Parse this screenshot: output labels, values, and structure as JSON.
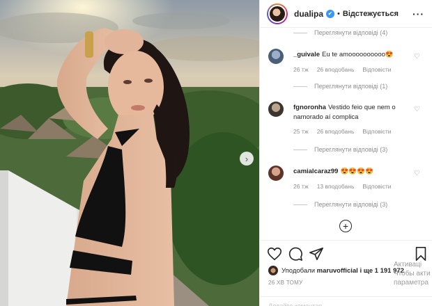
{
  "header": {
    "username": "dualipa",
    "verified_symbol": "✔",
    "separator": "•",
    "follow_status": "Відстежується",
    "more_symbol": "···"
  },
  "comments": {
    "top_view_replies": "Переглянути відповіді (4)",
    "items": [
      {
        "username": "_guivale",
        "text": "Eu te amoooooooooo😍",
        "age": "26 тж",
        "likes": "26 вподобань",
        "reply": "Відповісти",
        "view_replies": "Переглянути відповіді (1)"
      },
      {
        "username": "fgnoronha",
        "text": "Vestido feio que nem o namorado aí complica",
        "age": "25 тж",
        "likes": "26 вподобань",
        "reply": "Відповісти",
        "view_replies": "Переглянути відповіді (3)"
      },
      {
        "username": "camialcaraz99",
        "text": "😍😍😍😍",
        "age": "26 тж",
        "likes": "13 вподобань",
        "reply": "Відповісти",
        "view_replies": "Переглянути відповіді (3)"
      }
    ],
    "load_more_symbol": "+"
  },
  "actions": {
    "liked_by_prefix": "Уподобали",
    "liked_by_user": "maruvofficial",
    "liked_by_suffix": "і ще 1 191 972",
    "time_ago": "26 ХВ ТОМУ",
    "add_comment_placeholder": "Додайте коментар..."
  },
  "watermark": {
    "line1": "Активаці",
    "line2": "Чтобы акти",
    "line3": "параметра"
  },
  "photo": {
    "next_symbol": "›"
  },
  "colors": {
    "verified": "#3897f0",
    "text": "#262626",
    "muted": "#8e8e8e",
    "sky": "#c9c3b8",
    "palm": "#3f6a2e",
    "swimsuit": "#111111"
  }
}
